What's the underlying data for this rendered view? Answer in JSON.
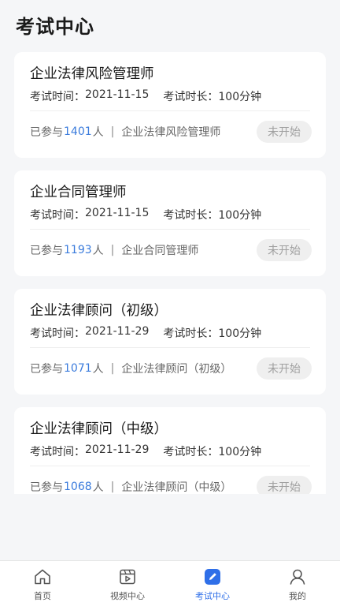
{
  "page": {
    "title": "考试中心"
  },
  "exams": [
    {
      "title": "企业法律风险管理师",
      "time_label": "考试时间：",
      "date": "2021-11-15",
      "duration_label": "考试时长：",
      "duration": "100分钟",
      "joined_prefix": "已参与",
      "count": "1401",
      "joined_suffix": "人",
      "separator": "|",
      "category": "企业法律风险管理师",
      "status": "未开始"
    },
    {
      "title": "企业合同管理师",
      "time_label": "考试时间：",
      "date": "2021-11-15",
      "duration_label": "考试时长：",
      "duration": "100分钟",
      "joined_prefix": "已参与",
      "count": "1193",
      "joined_suffix": "人",
      "separator": "|",
      "category": "企业合同管理师",
      "status": "未开始"
    },
    {
      "title": "企业法律顾问（初级）",
      "time_label": "考试时间：",
      "date": "2021-11-29",
      "duration_label": "考试时长：",
      "duration": "100分钟",
      "joined_prefix": "已参与",
      "count": "1071",
      "joined_suffix": "人",
      "separator": "|",
      "category": "企业法律顾问（初级）",
      "status": "未开始"
    },
    {
      "title": "企业法律顾问（中级）",
      "time_label": "考试时间：",
      "date": "2021-11-29",
      "duration_label": "考试时长：",
      "duration": "100分钟",
      "joined_prefix": "已参与",
      "count": "1068",
      "joined_suffix": "人",
      "separator": "|",
      "category": "企业法律顾问（中级）",
      "status": "未开始"
    }
  ],
  "tabbar": {
    "items": [
      {
        "label": "首页",
        "icon": "home-icon"
      },
      {
        "label": "视频中心",
        "icon": "video-icon"
      },
      {
        "label": "考试中心",
        "icon": "exam-edit-icon",
        "active": true
      },
      {
        "label": "我的",
        "icon": "profile-icon"
      }
    ]
  },
  "colors": {
    "accent": "#2f6fe8",
    "count": "#3a7bdc",
    "status_bg": "#efefef",
    "status_text": "#a0a0a0"
  }
}
